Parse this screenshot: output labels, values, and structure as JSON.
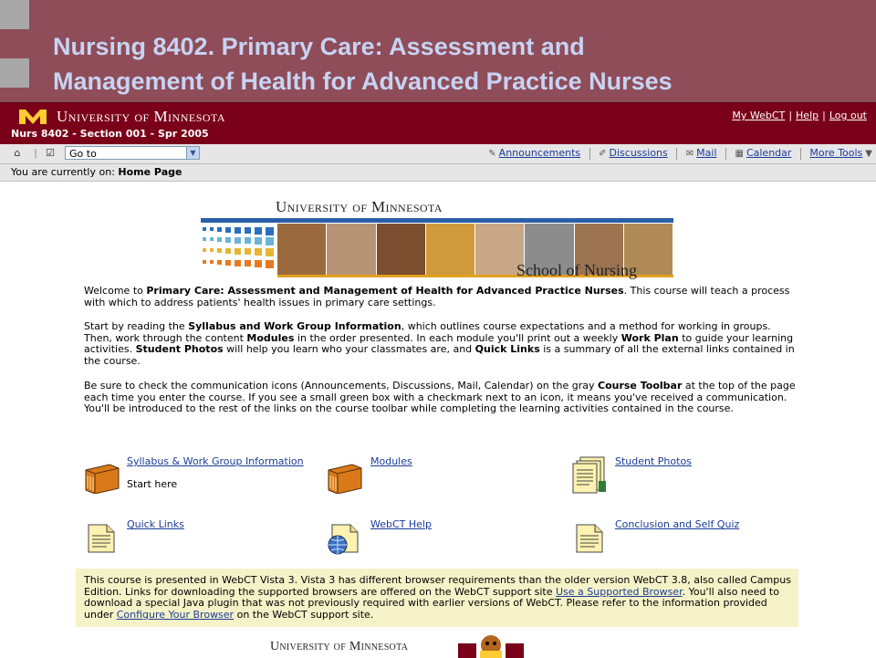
{
  "slide": {
    "title_line1": "Nursing 8402. Primary Care: Assessment and",
    "title_line2": "Management of Health for Advanced Practice Nurses"
  },
  "header": {
    "university": "University of Minnesota",
    "course": "Nurs 8402 - Section 001 - Spr 2005",
    "links": [
      "My WebCT",
      "Help",
      "Log out"
    ]
  },
  "toolbar": {
    "goto": "Go to",
    "tools": [
      {
        "label": "Announcements",
        "icon": "announcements-icon"
      },
      {
        "label": "Discussions",
        "icon": "discussions-icon"
      },
      {
        "label": "Mail",
        "icon": "mail-icon"
      },
      {
        "label": "Calendar",
        "icon": "calendar-icon"
      },
      {
        "label": "More Tools",
        "icon": "chevron-down-icon"
      }
    ]
  },
  "location": {
    "prefix": "You are currently on:",
    "page": "Home Page"
  },
  "banner": {
    "university": "University of Minnesota",
    "school": "School of Nursing"
  },
  "intro": {
    "p1": [
      {
        "t": "Welcome to "
      },
      {
        "t": "Primary Care: Assessment and Management of Health for Advanced Practice Nurses",
        "b": true
      },
      {
        "t": ". This course will teach a process with which to address patients' health issues in primary care settings."
      }
    ],
    "p2": [
      {
        "t": "Start by reading the "
      },
      {
        "t": "Syllabus and Work Group Information",
        "b": true
      },
      {
        "t": ", which outlines course expectations and a method for working in groups. Then, work through the content "
      },
      {
        "t": "Modules",
        "b": true
      },
      {
        "t": " in the order presented. In each module you'll print out a weekly "
      },
      {
        "t": "Work Plan",
        "b": true
      },
      {
        "t": " to guide your learning activities. "
      },
      {
        "t": "Student Photos",
        "b": true
      },
      {
        "t": " will help you learn who your classmates are, and "
      },
      {
        "t": "Quick Links",
        "b": true
      },
      {
        "t": " is a summary of all the external links contained in the course."
      }
    ],
    "p3": [
      {
        "t": "Be sure to check the communication icons (Announcements, Discussions, Mail, Calendar) on the gray "
      },
      {
        "t": "Course Toolbar",
        "b": true
      },
      {
        "t": " at the top of the page each time you enter the course. If you see a small green box with a checkmark next to an icon, it means you've received a communication. You'll be introduced to the rest of the links on the course toolbar while completing the learning activities contained in the course."
      }
    ]
  },
  "items": {
    "syllabus": {
      "label": "Syllabus & Work Group Information",
      "sub": "Start here"
    },
    "modules": {
      "label": "Modules"
    },
    "photos": {
      "label": "Student Photos"
    },
    "quicklinks": {
      "label": "Quick Links"
    },
    "webcthelp": {
      "label": "WebCT Help"
    },
    "conclusion": {
      "label": "Conclusion and Self Quiz"
    }
  },
  "notice": [
    {
      "t": "This course is presented in WebCT Vista 3. Vista 3 has different browser requirements than the older version WebCT 3.8, also called Campus Edition. Links for downloading the supported browsers are offered on the WebCT support site "
    },
    {
      "t": "Use a Supported Browser",
      "link": true
    },
    {
      "t": ". You'll also need to download a special Java plugin that was not previously required with earlier versions of WebCT. Please refer to the information provided under "
    },
    {
      "t": "Configure Your Browser",
      "link": true
    },
    {
      "t": " on the WebCT support site."
    }
  ],
  "footer": {
    "university": "University of Minnesota"
  },
  "colors": {
    "slide_bg": "#8e4d58",
    "umn_maroon": "#7a0019",
    "umn_gold": "#ffcc33",
    "link": "#1a3c98",
    "notice_bg": "#f5f2c8"
  }
}
